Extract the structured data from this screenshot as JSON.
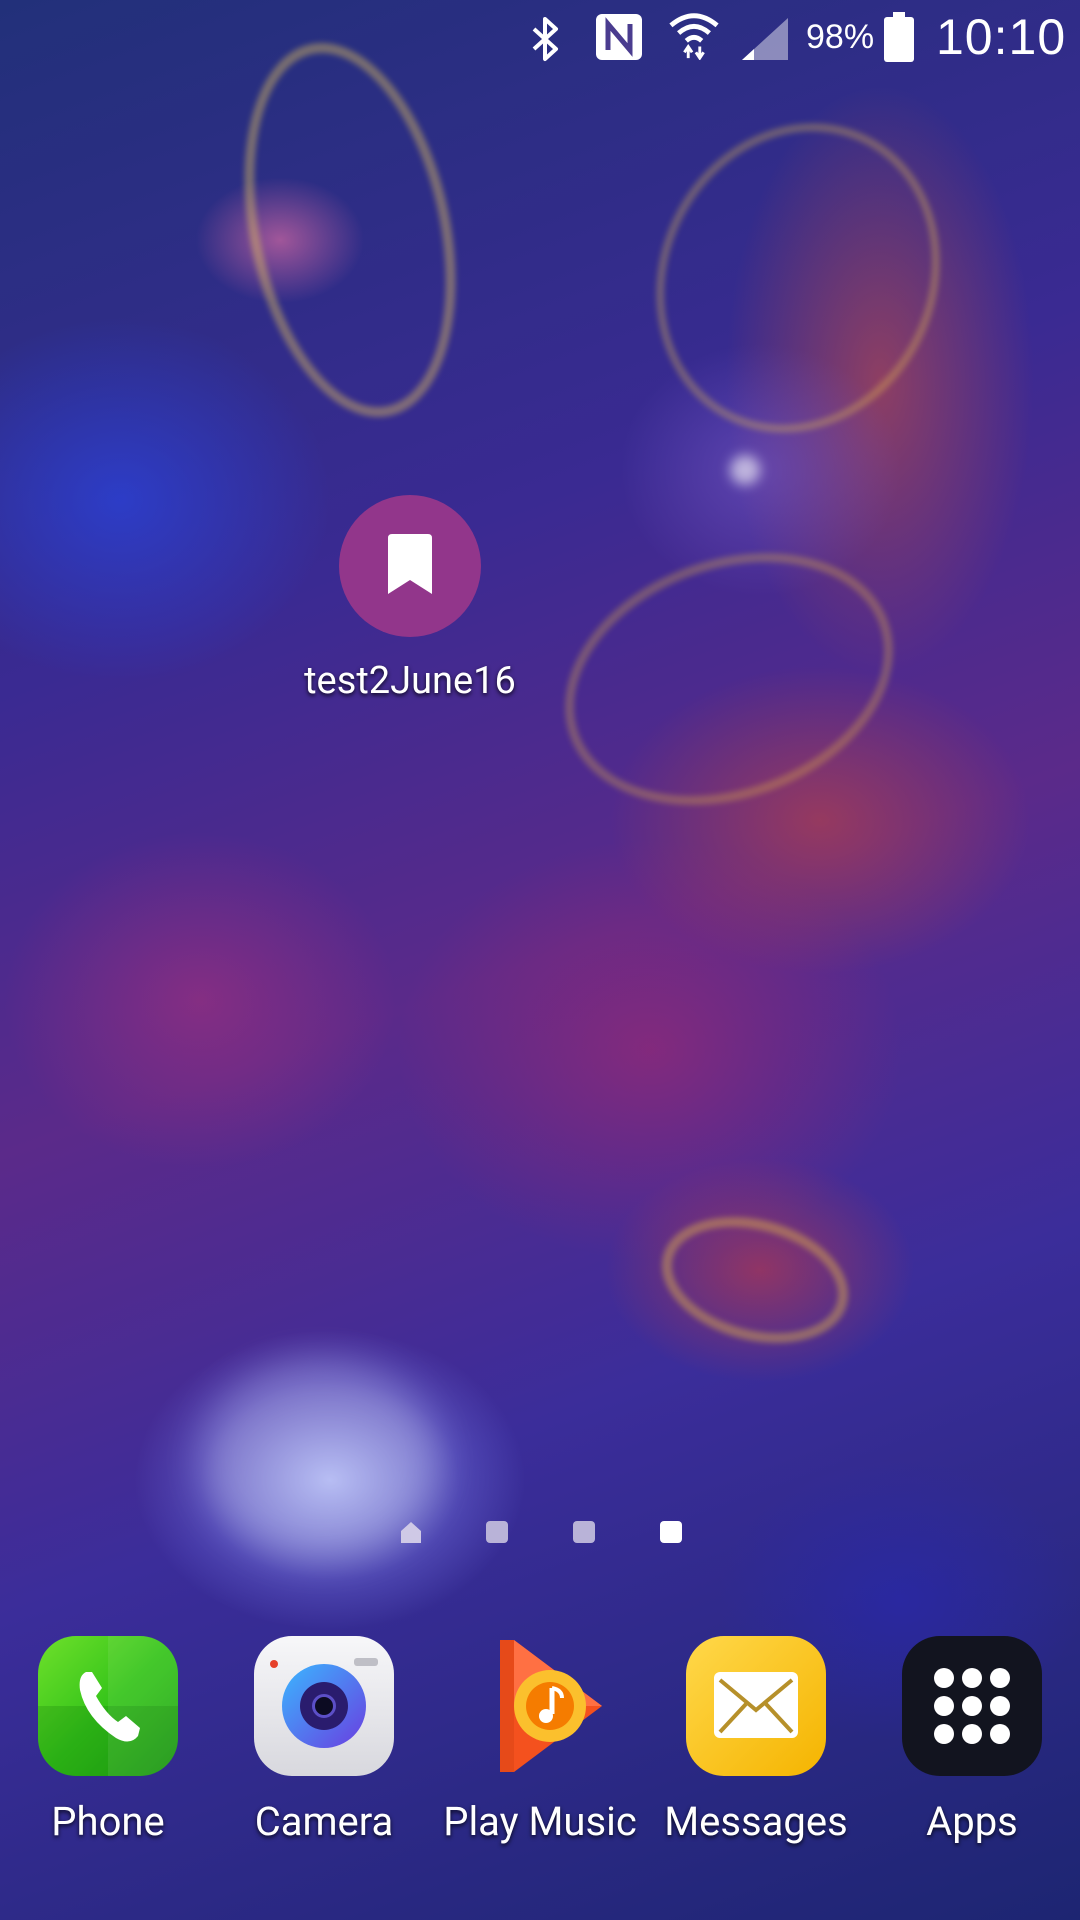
{
  "status_bar": {
    "battery_percent": "98%",
    "time": "10:10",
    "icons": [
      "bluetooth-icon",
      "nfc-icon",
      "wifi-icon",
      "cell-signal-icon",
      "battery-icon"
    ]
  },
  "home_screen": {
    "shortcut": {
      "label": "test2June16",
      "icon": "bookmark-icon",
      "color": "#92368b"
    },
    "page_indicator": {
      "pages": [
        "home",
        "page",
        "page",
        "page"
      ],
      "active_index": 3
    }
  },
  "dock": {
    "items": [
      {
        "label": "Phone",
        "icon": "phone-icon",
        "color": "#3cc21b"
      },
      {
        "label": "Camera",
        "icon": "camera-icon",
        "color": "#e8e8ee"
      },
      {
        "label": "Play Music",
        "icon": "play-music-icon",
        "color": "#f4811f"
      },
      {
        "label": "Messages",
        "icon": "messages-icon",
        "color": "#f8c21a"
      },
      {
        "label": "Apps",
        "icon": "apps-grid-icon",
        "color": "#12141f"
      }
    ]
  }
}
